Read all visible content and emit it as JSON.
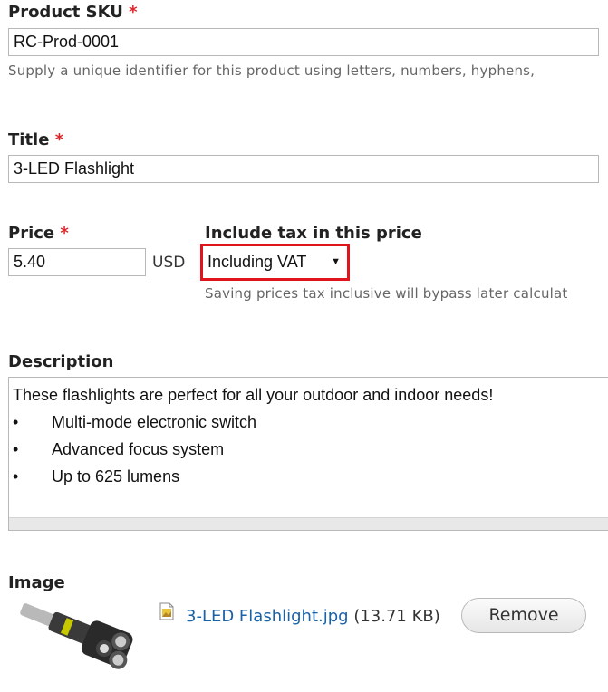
{
  "sku": {
    "label": "Product SKU",
    "required_mark": "*",
    "value": "RC-Prod-0001",
    "help": "Supply a unique identifier for this product using letters, numbers, hyphens,"
  },
  "title": {
    "label": "Title",
    "required_mark": "*",
    "value": "3-LED Flashlight"
  },
  "price": {
    "label": "Price",
    "required_mark": "*",
    "value": "5.40",
    "currency": "USD"
  },
  "tax": {
    "label": "Include tax in this price",
    "selected": "Including VAT",
    "help": "Saving prices tax inclusive will bypass later calculat"
  },
  "description": {
    "label": "Description",
    "intro": "These flashlights are perfect for all your outdoor and indoor needs!",
    "bullet_char": "•",
    "bullets": [
      "Multi-mode electronic switch",
      "Advanced focus system",
      "Up to 625 lumens"
    ]
  },
  "image": {
    "label": "Image",
    "file_name": "3-LED Flashlight.jpg",
    "file_size": "(13.71 KB)",
    "remove_label": "Remove"
  },
  "colors": {
    "required": "#e0252a",
    "highlight_border": "#e0141c",
    "link": "#1a62a6"
  }
}
